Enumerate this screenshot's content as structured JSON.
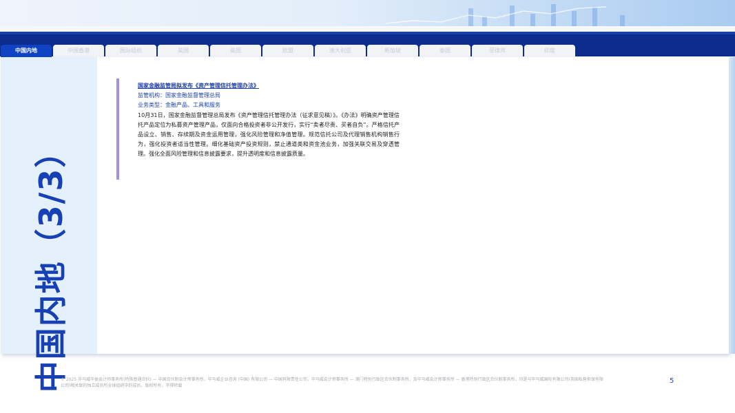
{
  "tabs": [
    {
      "label": "中国内地",
      "active": true
    },
    {
      "label": "中国香港"
    },
    {
      "label": "国际组织"
    },
    {
      "label": "美国"
    },
    {
      "label": "英国"
    },
    {
      "label": "欧盟"
    },
    {
      "label": "澳大利亚"
    },
    {
      "label": "新加坡"
    },
    {
      "label": "泰国"
    },
    {
      "label": "菲律宾"
    },
    {
      "label": "印度"
    }
  ],
  "side_title": "中国内地（3/3）",
  "article": {
    "title": "国家金融监管局拟发布《资产管理信托管理办法》",
    "regulator": "监管机构：国家金融监督管理总局",
    "business_type": "业务类型：金融产品、工具和服务",
    "body": "10月31日，国家金融监督管理总局发布《资产管理信托管理办法（征求意见稿）》。《办法》明确资产管理信托产品定位为私募资产管理产品，仅面向合格投资者非公开发行，实行“卖者尽责、买者自负”。严格信托产品设立、销售、存续期及资金运用管理，强化风险管理和净值管理。规范信托公司及代理销售机构销售行为，强化投资者适当性管理。细化基础资产投资规则，禁止通道类和资金池业务，加强关联交易及穿透管理。强化全面风险管理和信息披露要求，提升透明度和信息披露质量。"
  },
  "footer": {
    "copyright": "© 2025 毕马威华振会计师事务所(特殊普通合伙) — 中国合伙制会计师事务所，毕马威企业咨询 (中国) 有限公司 — 中国有限责任公司，毕马威会计师事务所 — 澳门特别行政区合伙制事务所，及毕马威会计师事务所 — 香港特别行政区合伙制事务所，均是与毕马威国际有限公司(英国私营担保有限公司)相关联的独立成员所全球组织中的成员。版权所有，不得转载"
  },
  "page_number": "5",
  "colors": {
    "navy": "#0c2b8c",
    "accent_blue": "#1c3fb0",
    "tab_active": "#1043c4",
    "side_panel": "#e4f0fb",
    "accent_bar": "#a48fe0"
  }
}
